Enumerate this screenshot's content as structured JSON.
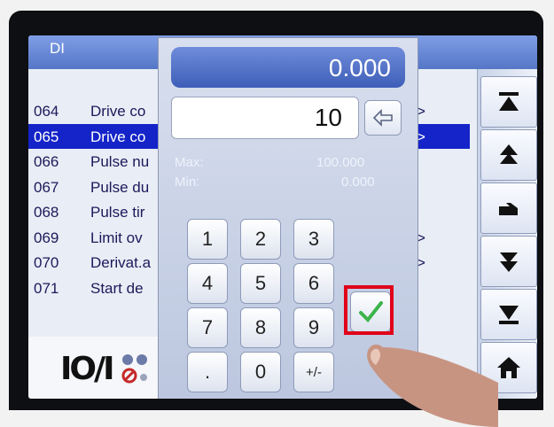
{
  "window": {
    "title": "DI"
  },
  "list": [
    {
      "id": "064",
      "name": "Drive co",
      "marker": ">",
      "selected": false
    },
    {
      "id": "065",
      "name": "Drive co",
      "marker": ">",
      "selected": true
    },
    {
      "id": "066",
      "name": "Pulse nu",
      "marker": "",
      "selected": false
    },
    {
      "id": "067",
      "name": "Pulse du",
      "marker": "",
      "selected": false
    },
    {
      "id": "068",
      "name": "Pulse tir",
      "marker": "",
      "selected": false
    },
    {
      "id": "069",
      "name": "Limit ov",
      "marker": ">",
      "selected": false
    },
    {
      "id": "070",
      "name": "Derivat.a",
      "marker": ">",
      "selected": false
    },
    {
      "id": "071",
      "name": "Start de",
      "marker": "",
      "selected": false
    }
  ],
  "toolbar": {
    "logo": "IO/I"
  },
  "keypad": {
    "result": "0.000",
    "entry": "10",
    "max_label": "Max:",
    "max_value": "100.000",
    "min_label": "Min:",
    "min_value": "0.000",
    "keys": [
      "1",
      "2",
      "3",
      "4",
      "5",
      "6",
      "7",
      "8",
      "9",
      ".",
      "0",
      "+/-"
    ]
  },
  "nav": {
    "icons": [
      "jump-top-icon",
      "page-up-icon",
      "hand-icon",
      "page-down-icon",
      "jump-bottom-icon",
      "home-icon"
    ]
  },
  "colors": {
    "selection": "#1424c8",
    "titlebar": "#5576c6",
    "enter_check": "#3cb44a",
    "highlight": "#e0001a"
  }
}
